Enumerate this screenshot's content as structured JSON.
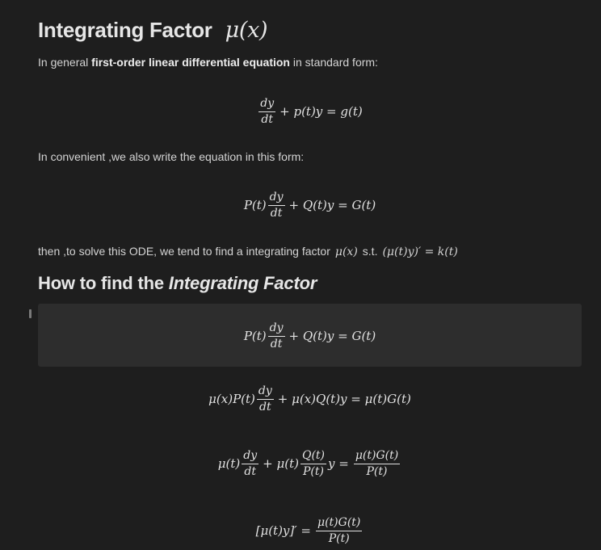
{
  "heading1": {
    "text": "Integrating Factor",
    "math": "μ(x)"
  },
  "para1": {
    "prefix": "In general ",
    "bold": "first-order linear differential equation",
    "suffix": " in standard form:"
  },
  "eq1": {
    "frac_num": "dy",
    "frac_den": "dt",
    "rest": "+ p(t)y = g(t)"
  },
  "para2": {
    "text": "In convenient ,we also write the equation in this form:"
  },
  "eq2": {
    "lead": "P(t)",
    "frac_num": "dy",
    "frac_den": "dt",
    "rest": "+ Q(t)y = G(t)"
  },
  "para3": {
    "text": "then ,to solve this ODE, we tend to find a integrating factor",
    "math1": "μ(x)",
    "st": "s.t.",
    "math2": "(μ(t)y)′ = k(t)"
  },
  "heading2": {
    "text": "How to find the ",
    "italic": "Integrating Factor"
  },
  "eq3": {
    "lead": "P(t)",
    "frac_num": "dy",
    "frac_den": "dt",
    "rest": "+ Q(t)y = G(t)"
  },
  "eq4": {
    "lead": "μ(x)P(t)",
    "frac_num": "dy",
    "frac_den": "dt",
    "rest": "+ μ(x)Q(t)y = μ(t)G(t)"
  },
  "eq5": {
    "lead": "μ(t)",
    "frac1_num": "dy",
    "frac1_den": "dt",
    "mid": "+ μ(t)",
    "frac2_num": "Q(t)",
    "frac2_den": "P(t)",
    "after": "y =",
    "frac3_num": "μ(t)G(t)",
    "frac3_den": "P(t)"
  },
  "eq6": {
    "lead": "[μ(t)y]′ =",
    "frac_num": "μ(t)G(t)",
    "frac_den": "P(t)"
  },
  "colors": {
    "background": "#1e1e1e",
    "highlight": "#2d2d2d",
    "text": "#dadada"
  }
}
